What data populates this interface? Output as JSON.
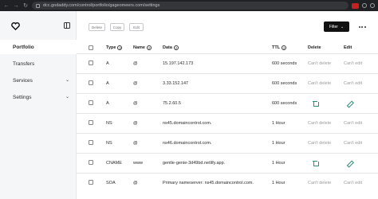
{
  "browser": {
    "url": "dcc.godaddy.com/control/portfolio/gageomeers.com/settings"
  },
  "sidebar": {
    "items": [
      {
        "label": "Portfolio"
      },
      {
        "label": "Transfers"
      },
      {
        "label": "Services"
      },
      {
        "label": "Settings"
      }
    ]
  },
  "toolbar": {
    "delete_label": "Delete",
    "copy_label": "Copy",
    "edit_label": "Edit",
    "filter_label": "Filter"
  },
  "table": {
    "headers": {
      "type": "Type",
      "name": "Name",
      "data": "Data",
      "ttl": "TTL",
      "delete": "Delete",
      "edit": "Edit"
    },
    "rows": [
      {
        "type": "A",
        "name": "@",
        "data": "15.197.142.173",
        "ttl": "600 seconds",
        "delete": "Can't delete",
        "edit": "Can't edit"
      },
      {
        "type": "A",
        "name": "@",
        "data": "3.33.152.147",
        "ttl": "600 seconds",
        "delete": "Can't delete",
        "edit": "Can't edit"
      },
      {
        "type": "A",
        "name": "@",
        "data": "75.2.60.5",
        "ttl": "600 seconds",
        "delete": "",
        "edit": ""
      },
      {
        "type": "NS",
        "name": "@",
        "data": "ns45.domaincontrol.com.",
        "ttl": "1 Hour",
        "delete": "Can't delete",
        "edit": "Can't edit"
      },
      {
        "type": "NS",
        "name": "@",
        "data": "ns46.domaincontrol.com.",
        "ttl": "1 Hour",
        "delete": "Can't delete",
        "edit": "Can't edit"
      },
      {
        "type": "CNAME",
        "name": "www",
        "data": "gentle-genie-3d49bd.netlify.app.",
        "ttl": "1 Hour",
        "delete": "",
        "edit": ""
      },
      {
        "type": "SOA",
        "name": "@",
        "data": "Primary nameserver: ns45.domaincontrol.com.",
        "ttl": "1 Hour",
        "delete": "Can't delete",
        "edit": "Can't edit"
      }
    ]
  },
  "colors": {
    "accent": "#2e8b7a",
    "sidebar_bg": "#f5f6f8",
    "filter_bg": "#111111"
  }
}
